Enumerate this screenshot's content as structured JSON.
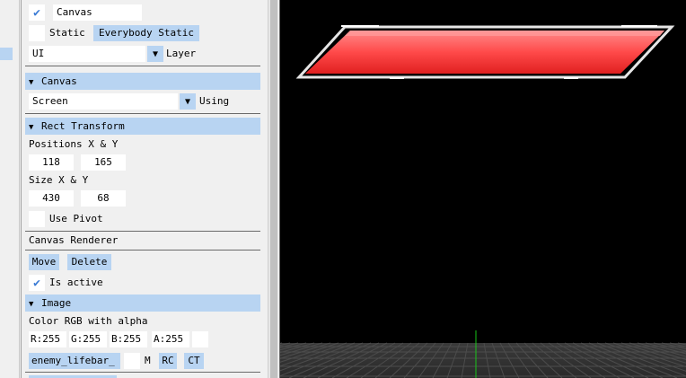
{
  "game_object": {
    "name": "Canvas",
    "active_checked": true,
    "static_label": "Static",
    "static_value": "Everybody Static",
    "layer_value": "UI",
    "layer_label": "Layer"
  },
  "canvas": {
    "header": "Canvas",
    "render_mode": "Screen",
    "using_label": "Using"
  },
  "rect_transform": {
    "header": "Rect Transform",
    "positions_label": "Positions X & Y",
    "pos_x": "118",
    "pos_y": "165",
    "size_label": "Size X & Y",
    "size_x": "430",
    "size_y": "68",
    "use_pivot_label": "Use Pivot",
    "use_pivot_checked": false
  },
  "canvas_renderer": {
    "header": "Canvas Renderer",
    "move_label": "Move",
    "delete_label": "Delete",
    "is_active_label": "Is active",
    "is_active_checked": true
  },
  "image": {
    "header": "Image",
    "color_label": "Color RGB with alpha",
    "r": "R:255",
    "g": "G:255",
    "b": "B:255",
    "a": "A:255",
    "texture_name": "enemy_lifebar_",
    "m_label": "M",
    "rc_label": "RC",
    "ct_label": "CT"
  },
  "icons": [
    "checkmark-icon",
    "triangle-down-icon"
  ],
  "colors": {
    "accent": "#b8d4f2",
    "check": "#3a7bd5",
    "lifebar_fill": "#ff4a4a",
    "viewport_bg": "#000000"
  }
}
